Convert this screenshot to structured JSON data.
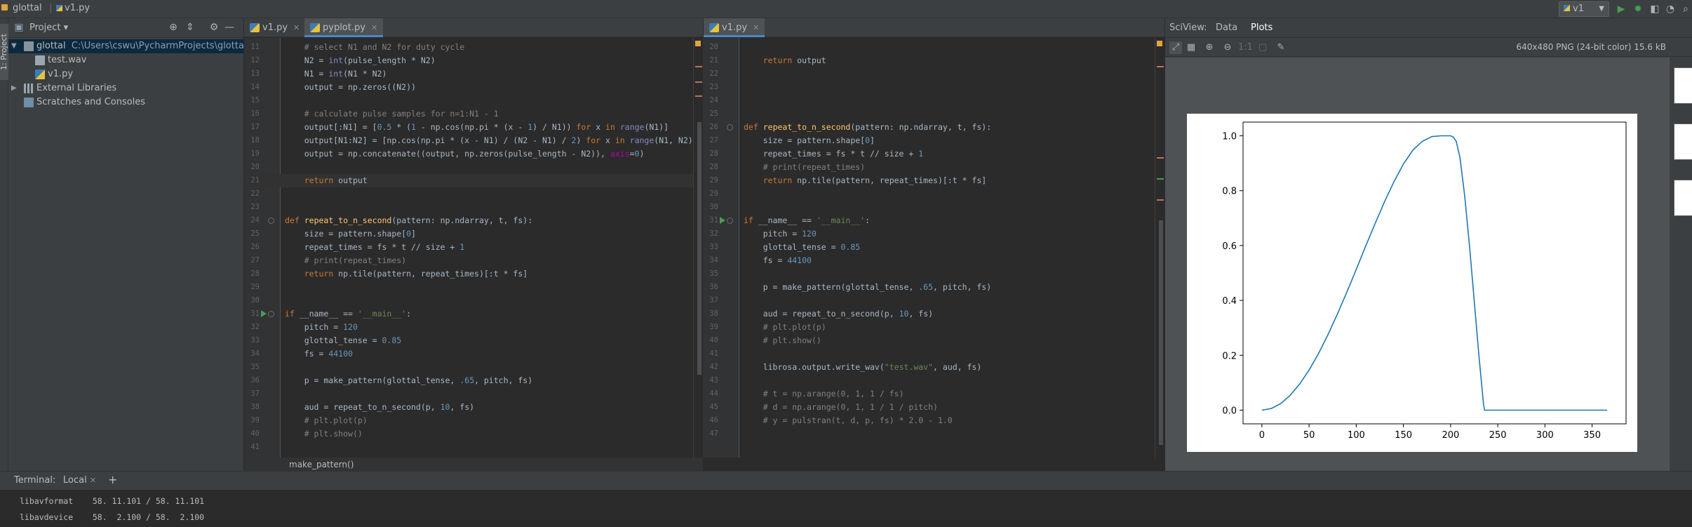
{
  "nav": {
    "project": "glottal",
    "file": "v1.py",
    "run_config": "v1"
  },
  "left_strip": {
    "project_tab": "1: Project"
  },
  "project_panel": {
    "title": "Project",
    "tree": [
      {
        "label": "glottal",
        "path": "C:\\Users\\cswu\\PycharmProjects\\glottal"
      },
      {
        "label": "test.wav"
      },
      {
        "label": "v1.py"
      },
      {
        "label": "External Libraries"
      },
      {
        "label": "Scratches and Consoles"
      }
    ]
  },
  "tabs_left": [
    {
      "label": "v1.py"
    },
    {
      "label": "pyplot.py"
    }
  ],
  "tabs_right": [
    {
      "label": "v1.py"
    }
  ],
  "editor_left": {
    "lines": [
      {
        "n": "11",
        "html": "    <span class=\"cm\"># select N1 and N2 for duty cycle</span>"
      },
      {
        "n": "12",
        "html": "    N2 = <span class=\"bi\">int</span>(pulse_length * N2)"
      },
      {
        "n": "13",
        "html": "    N1 = <span class=\"bi\">int</span>(N1 * N2)"
      },
      {
        "n": "14",
        "html": "    output = np.zeros((N2))"
      },
      {
        "n": "15",
        "html": ""
      },
      {
        "n": "16",
        "html": "    <span class=\"cm\"># calculate pulse samples for n=1:N1 - 1</span>"
      },
      {
        "n": "17",
        "html": "    output[:N1] = [<span class=\"num\">0.5</span> * (<span class=\"num\">1</span> - np.cos(np.pi * (x - <span class=\"num\">1</span>) / N1)) <span class=\"kw\">for</span> x <span class=\"kw\">in</span> <span class=\"bi\">range</span>(N1)]"
      },
      {
        "n": "18",
        "html": "    output[N1:N2] = [np.cos(np.pi * (x - N1) / (N2 - N1) / <span class=\"num\">2</span>) <span class=\"kw\">for</span> x <span class=\"kw\">in</span> <span class=\"bi\">range</span>(N1, N2)]"
      },
      {
        "n": "19",
        "html": "    output = np.concatenate((output, np.zeros(pulse_length - N2)), <span class=\"dn\">axis</span>=<span class=\"num\">0</span>)"
      },
      {
        "n": "20",
        "html": ""
      },
      {
        "n": "21",
        "html": "    <span class=\"kw\">return</span> output",
        "cur": true
      },
      {
        "n": "22",
        "html": ""
      },
      {
        "n": "23",
        "html": ""
      },
      {
        "n": "24",
        "html": "<span class=\"kw\">def</span> <span class=\"fn\">repeat_to_n_second</span>(pattern: np.ndarray, t, fs):"
      },
      {
        "n": "25",
        "html": "    size = pattern.shape[<span class=\"num\">0</span>]"
      },
      {
        "n": "26",
        "html": "    repeat_times = fs * t // size + <span class=\"num\">1</span>"
      },
      {
        "n": "27",
        "html": "    <span class=\"cm\"># print(repeat_times)</span>"
      },
      {
        "n": "28",
        "html": "    <span class=\"kw\">return</span> np.tile(pattern, repeat_times)[:t * fs]"
      },
      {
        "n": "29",
        "html": ""
      },
      {
        "n": "30",
        "html": ""
      },
      {
        "n": "31",
        "html": "<span class=\"kw\">if</span> __name__ == <span class=\"st\">'__main__'</span>:"
      },
      {
        "n": "32",
        "html": "    pitch = <span class=\"num\">120</span>"
      },
      {
        "n": "33",
        "html": "    glottal_tense = <span class=\"num\">0.85</span>"
      },
      {
        "n": "34",
        "html": "    fs = <span class=\"num\">44100</span>"
      },
      {
        "n": "35",
        "html": ""
      },
      {
        "n": "36",
        "html": "    p = make_pattern(glottal_tense, <span class=\"num\">.65</span>, pitch, fs)"
      },
      {
        "n": "37",
        "html": ""
      },
      {
        "n": "38",
        "html": "    aud = repeat_to_n_second(p, <span class=\"num\">10</span>, fs)"
      },
      {
        "n": "39",
        "html": "    <span class=\"cm\"># plt.plot(p)</span>"
      },
      {
        "n": "40",
        "html": "    <span class=\"cm\"># plt.show()</span>"
      },
      {
        "n": "41",
        "html": ""
      }
    ]
  },
  "editor_right": {
    "lines": [
      {
        "n": "20",
        "html": ""
      },
      {
        "n": "21",
        "html": "    <span class=\"kw\">return</span> output"
      },
      {
        "n": "22",
        "html": ""
      },
      {
        "n": "23",
        "html": ""
      },
      {
        "n": "24",
        "html": ""
      },
      {
        "n": "25",
        "html": ""
      },
      {
        "n": "26",
        "html": "<span class=\"kw\">def</span> <span class=\"fn\">repeat_to_n_second</span>(pattern: np.ndarray, t, fs):"
      },
      {
        "n": "27",
        "html": "    size = pattern.shape[<span class=\"num\">0</span>]"
      },
      {
        "n": "28",
        "html": "    repeat_times = fs * t // size + <span class=\"num\">1</span>"
      },
      {
        "n": "28",
        "html": "    <span class=\"cm\"># print(repeat_times)</span>"
      },
      {
        "n": "29",
        "html": "    <span class=\"kw\">return</span> np.tile(pattern, repeat_times)[:t * fs]"
      },
      {
        "n": "29",
        "html": ""
      },
      {
        "n": "30",
        "html": ""
      },
      {
        "n": "31",
        "html": "<span class=\"kw\">if</span> __name__ == <span class=\"st\">'__main__'</span>:"
      },
      {
        "n": "32",
        "html": "    pitch = <span class=\"num\">120</span>"
      },
      {
        "n": "33",
        "html": "    glottal_tense = <span class=\"num\">0.85</span>"
      },
      {
        "n": "34",
        "html": "    fs = <span class=\"num\">44100</span>"
      },
      {
        "n": "35",
        "html": ""
      },
      {
        "n": "36",
        "html": "    p = make_pattern(glottal_tense, <span class=\"num\">.65</span>, pitch, fs)"
      },
      {
        "n": "37",
        "html": ""
      },
      {
        "n": "38",
        "html": "    aud = repeat_to_n_second(p, <span class=\"num\">10</span>, fs)"
      },
      {
        "n": "39",
        "html": "    <span class=\"cm\"># plt.plot(p)</span>"
      },
      {
        "n": "40",
        "html": "    <span class=\"cm\"># plt.show()</span>"
      },
      {
        "n": "41",
        "html": ""
      },
      {
        "n": "42",
        "html": "    librosa.output.write_wav(<span class=\"st\">\"test.wav\"</span>, aud, fs)"
      },
      {
        "n": "43",
        "html": ""
      },
      {
        "n": "44",
        "html": "    <span class=\"cm\"># t = np.arange(0, 1, 1 / fs)</span>"
      },
      {
        "n": "45",
        "html": "    <span class=\"cm\"># d = np.arange(0, 1, 1 / 1 / pitch)</span>"
      },
      {
        "n": "46",
        "html": "    <span class=\"cm\"># y = pulstran(t, d, p, fs) * 2.0 - 1.0</span>"
      },
      {
        "n": "47",
        "html": ""
      }
    ]
  },
  "breadcrumb": "make_pattern()",
  "sciview": {
    "title": "SciView:",
    "tabs": [
      "Data",
      "Plots"
    ],
    "image_info": "640x480 PNG (24-bit color) 15.6 kB"
  },
  "chart_data": {
    "type": "line",
    "title": "",
    "xlabel": "",
    "ylabel": "",
    "xlim": [
      -20,
      386
    ],
    "ylim": [
      -0.05,
      1.05
    ],
    "x_ticks": [
      0,
      50,
      100,
      150,
      200,
      250,
      300,
      350
    ],
    "y_ticks": [
      0.0,
      0.2,
      0.4,
      0.6,
      0.8,
      1.0
    ],
    "grid": false,
    "color": "#1f77b4",
    "series": [
      {
        "x": [
          0,
          10,
          20,
          30,
          40,
          50,
          60,
          70,
          80,
          90,
          100,
          110,
          120,
          130,
          140,
          150,
          160,
          170,
          180,
          190,
          200,
          203,
          206,
          210,
          215,
          220,
          225,
          230,
          235,
          236,
          250,
          300,
          350,
          366
        ],
        "y": [
          0.0,
          0.006,
          0.024,
          0.054,
          0.095,
          0.146,
          0.206,
          0.275,
          0.35,
          0.43,
          0.513,
          0.598,
          0.68,
          0.76,
          0.833,
          0.897,
          0.948,
          0.98,
          0.997,
          1.0,
          1.0,
          0.995,
          0.98,
          0.92,
          0.78,
          0.6,
          0.4,
          0.2,
          0.02,
          0.0,
          0.0,
          0.0,
          0.0,
          0.0
        ]
      }
    ]
  },
  "terminal": {
    "title": "Terminal:",
    "tab": "Local",
    "lines": [
      "libavformat    58. 11.101 / 58. 11.101",
      "libavdevice    58.  2.100 / 58.  2.100"
    ]
  }
}
